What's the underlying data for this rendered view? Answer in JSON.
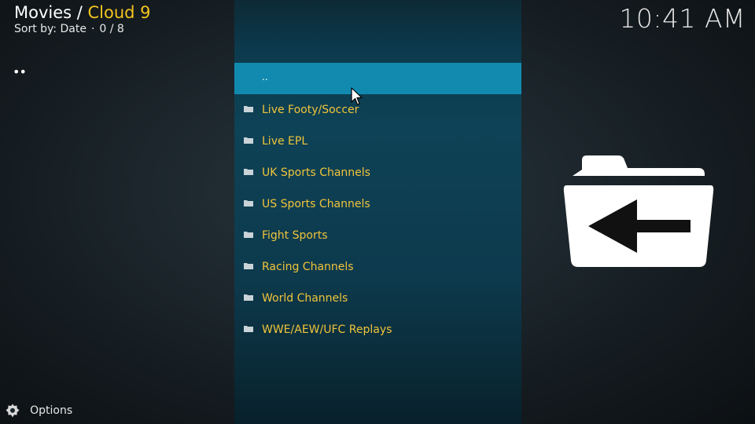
{
  "header": {
    "path_root": "Movies / ",
    "path_current": "Cloud 9",
    "sort_label": "Sort by: Date",
    "separator": "·",
    "count": "0 / 8"
  },
  "clock": "10:41 AM",
  "sidebar_glyph": "••",
  "list": {
    "items": [
      {
        "label": "..",
        "icon": "parent-folder",
        "selected": true
      },
      {
        "label": "Live Footy/Soccer",
        "icon": "folder-icon"
      },
      {
        "label": "Live EPL",
        "icon": "folder-icon"
      },
      {
        "label": "UK Sports Channels",
        "icon": "folder-icon"
      },
      {
        "label": "US Sports Channels",
        "icon": "folder-icon"
      },
      {
        "label": "Fight Sports",
        "icon": "folder-icon"
      },
      {
        "label": "Racing Channels",
        "icon": "folder-icon"
      },
      {
        "label": "World Channels",
        "icon": "folder-icon"
      },
      {
        "label": "WWE/AEW/UFC Replays",
        "icon": "folder-icon"
      }
    ]
  },
  "preview_icon": "folder-back-icon",
  "footer": {
    "options_label": "Options",
    "options_icon": "gear-icon"
  },
  "colors": {
    "accent": "#f3c41f",
    "item_text": "#f0c43a",
    "selection": "#128aaf",
    "panel": "#0e4256"
  }
}
